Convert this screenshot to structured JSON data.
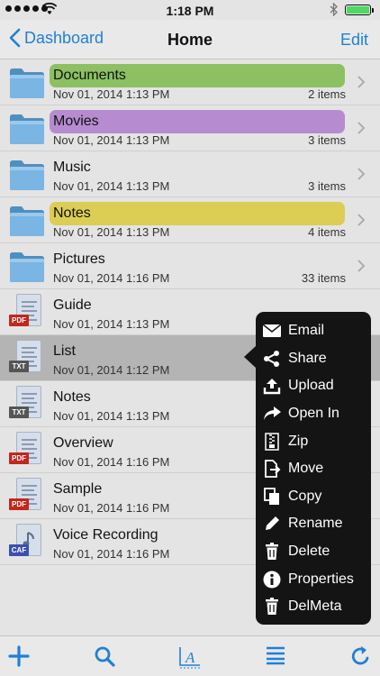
{
  "status_bar": {
    "time": "1:18 PM"
  },
  "nav": {
    "back_label": "Dashboard",
    "title": "Home",
    "edit_label": "Edit"
  },
  "items": [
    {
      "name": "Documents",
      "date": "Nov 01, 2014 1:13 PM",
      "meta": "2 items",
      "type": "folder",
      "highlight": "#8cc063"
    },
    {
      "name": "Movies",
      "date": "Nov 01, 2014 1:13 PM",
      "meta": "3 items",
      "type": "folder",
      "highlight": "#b68bd0"
    },
    {
      "name": "Music",
      "date": "Nov 01, 2014 1:13 PM",
      "meta": "3 items",
      "type": "folder",
      "highlight": ""
    },
    {
      "name": "Notes",
      "date": "Nov 01, 2014 1:13 PM",
      "meta": "4 items",
      "type": "folder",
      "highlight": "#dccd54"
    },
    {
      "name": "Pictures",
      "date": "Nov 01, 2014 1:16 PM",
      "meta": "33 items",
      "type": "folder",
      "highlight": ""
    },
    {
      "name": "Guide",
      "date": "Nov 01, 2014 1:13 PM",
      "meta": "",
      "type": "file",
      "badge": "PDF",
      "badge_color": "#c0281e"
    },
    {
      "name": "List",
      "date": "Nov 01, 2014 1:12 PM",
      "meta": "",
      "type": "file",
      "badge": "TXT",
      "badge_color": "#555555",
      "selected": true
    },
    {
      "name": "Notes",
      "date": "Nov 01, 2014 1:13 PM",
      "meta": "",
      "type": "file",
      "badge": "TXT",
      "badge_color": "#555555"
    },
    {
      "name": "Overview",
      "date": "Nov 01, 2014 1:16 PM",
      "meta": "",
      "type": "file",
      "badge": "PDF",
      "badge_color": "#c0281e"
    },
    {
      "name": "Sample",
      "date": "Nov 01, 2014 1:16 PM",
      "meta": "",
      "type": "file",
      "badge": "PDF",
      "badge_color": "#c0281e"
    },
    {
      "name": "Voice Recording",
      "date": "Nov 01, 2014 1:16 PM",
      "meta": "",
      "type": "audio",
      "badge": "CAF",
      "badge_color": "#3a4fb0"
    }
  ],
  "context_menu": [
    {
      "label": "Email",
      "icon": "email-icon"
    },
    {
      "label": "Share",
      "icon": "share-icon"
    },
    {
      "label": "Upload",
      "icon": "upload-icon"
    },
    {
      "label": "Open In",
      "icon": "open-in-icon"
    },
    {
      "label": "Zip",
      "icon": "zip-icon"
    },
    {
      "label": "Move",
      "icon": "move-icon"
    },
    {
      "label": "Copy",
      "icon": "copy-icon"
    },
    {
      "label": "Rename",
      "icon": "rename-icon"
    },
    {
      "label": "Delete",
      "icon": "trash-icon"
    },
    {
      "label": "Properties",
      "icon": "info-icon"
    },
    {
      "label": "DelMeta",
      "icon": "trash-icon"
    }
  ],
  "toolbar": [
    {
      "icon": "add-icon"
    },
    {
      "icon": "search-icon"
    },
    {
      "icon": "sort-icon"
    },
    {
      "icon": "list-icon"
    },
    {
      "icon": "refresh-icon"
    }
  ],
  "colors": {
    "accent": "#1f80d4",
    "menu_bg": "#141414",
    "selected_row": "#b4b4b4"
  }
}
